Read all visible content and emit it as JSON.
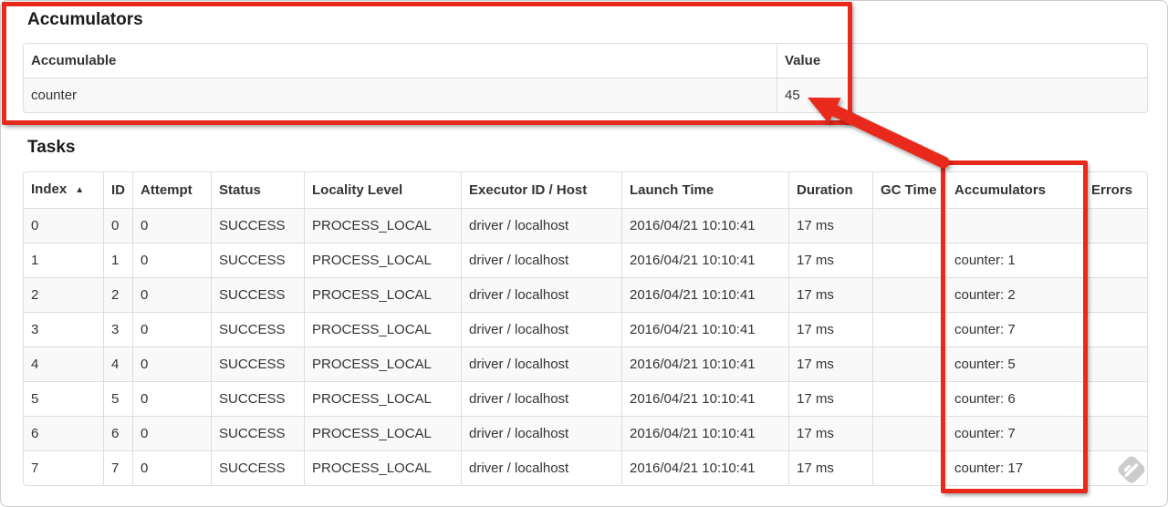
{
  "colors": {
    "annotation_red": "#e8291c",
    "table_border": "#dddddd",
    "stripe": "#f9f9f9",
    "text": "#333333",
    "watermark_gray": "#cacaca"
  },
  "accumulators_section": {
    "title": "Accumulators",
    "columns": [
      "Accumulable",
      "Value"
    ],
    "rows": [
      [
        "counter",
        "45"
      ]
    ]
  },
  "tasks_section": {
    "title": "Tasks",
    "sorted_column": "Index",
    "sort_indicator": "▲",
    "columns": [
      "Index",
      "ID",
      "Attempt",
      "Status",
      "Locality Level",
      "Executor ID / Host",
      "Launch Time",
      "Duration",
      "GC Time",
      "Accumulators",
      "Errors"
    ],
    "rows": [
      [
        "0",
        "0",
        "0",
        "SUCCESS",
        "PROCESS_LOCAL",
        "driver / localhost",
        "2016/04/21 10:10:41",
        "17 ms",
        "",
        "",
        ""
      ],
      [
        "1",
        "1",
        "0",
        "SUCCESS",
        "PROCESS_LOCAL",
        "driver / localhost",
        "2016/04/21 10:10:41",
        "17 ms",
        "",
        "counter: 1",
        ""
      ],
      [
        "2",
        "2",
        "0",
        "SUCCESS",
        "PROCESS_LOCAL",
        "driver / localhost",
        "2016/04/21 10:10:41",
        "17 ms",
        "",
        "counter: 2",
        ""
      ],
      [
        "3",
        "3",
        "0",
        "SUCCESS",
        "PROCESS_LOCAL",
        "driver / localhost",
        "2016/04/21 10:10:41",
        "17 ms",
        "",
        "counter: 7",
        ""
      ],
      [
        "4",
        "4",
        "0",
        "SUCCESS",
        "PROCESS_LOCAL",
        "driver / localhost",
        "2016/04/21 10:10:41",
        "17 ms",
        "",
        "counter: 5",
        ""
      ],
      [
        "5",
        "5",
        "0",
        "SUCCESS",
        "PROCESS_LOCAL",
        "driver / localhost",
        "2016/04/21 10:10:41",
        "17 ms",
        "",
        "counter: 6",
        ""
      ],
      [
        "6",
        "6",
        "0",
        "SUCCESS",
        "PROCESS_LOCAL",
        "driver / localhost",
        "2016/04/21 10:10:41",
        "17 ms",
        "",
        "counter: 7",
        ""
      ],
      [
        "7",
        "7",
        "0",
        "SUCCESS",
        "PROCESS_LOCAL",
        "driver / localhost",
        "2016/04/21 10:10:41",
        "17 ms",
        "",
        "counter: 17",
        ""
      ]
    ]
  }
}
